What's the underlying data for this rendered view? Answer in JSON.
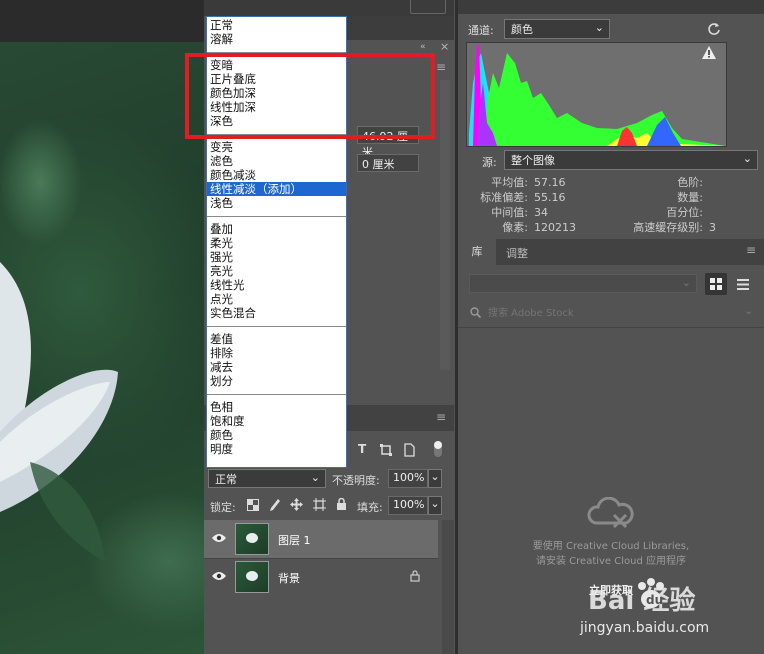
{
  "blend_menu": {
    "groups": [
      [
        "正常",
        "溶解"
      ],
      [
        "变暗",
        "正片叠底",
        "颜色加深",
        "线性加深",
        "深色"
      ],
      [
        "变亮",
        "滤色",
        "颜色减淡",
        "线性减淡（添加）",
        "浅色"
      ],
      [
        "叠加",
        "柔光",
        "强光",
        "亮光",
        "线性光",
        "点光",
        "实色混合"
      ],
      [
        "差值",
        "排除",
        "减去",
        "划分"
      ],
      [
        "色相",
        "饱和度",
        "颜色",
        "明度"
      ]
    ],
    "selected": "线性减淡（添加）"
  },
  "properties": {
    "width_value": "46.92 厘米",
    "offset_value": "0 厘米"
  },
  "layers": {
    "blend_mode": "正常",
    "opacity_label": "不透明度:",
    "opacity_value": "100%",
    "lock_label": "锁定:",
    "fill_label": "填充:",
    "fill_value": "100%",
    "items": [
      {
        "name": "图层 1",
        "locked": false,
        "selected": true
      },
      {
        "name": "背景",
        "locked": true,
        "selected": false
      }
    ]
  },
  "histogram": {
    "channel_label": "通道:",
    "channel_value": "颜色",
    "source_label": "源:",
    "source_value": "整个图像",
    "stats_left": [
      {
        "label": "平均值:",
        "value": "57.16"
      },
      {
        "label": "标准偏差:",
        "value": "55.16"
      },
      {
        "label": "中间值:",
        "value": "34"
      },
      {
        "label": "像素:",
        "value": "120213"
      }
    ],
    "stats_right": [
      {
        "label": "色阶:",
        "value": ""
      },
      {
        "label": "数量:",
        "value": ""
      },
      {
        "label": "百分位:",
        "value": ""
      },
      {
        "label": "高速缓存级别:",
        "value": "3"
      }
    ]
  },
  "library": {
    "tab_library": "库",
    "tab_adjust": "调整",
    "search_placeholder": "搜索 Adobe Stock",
    "message_line1": "要使用 Creative Cloud Libraries,",
    "message_line2": "请安装 Creative Cloud 应用程序",
    "action": "立即获取"
  },
  "watermark": {
    "brand": "Bai  经验",
    "url": "jingyan.baidu.com"
  }
}
